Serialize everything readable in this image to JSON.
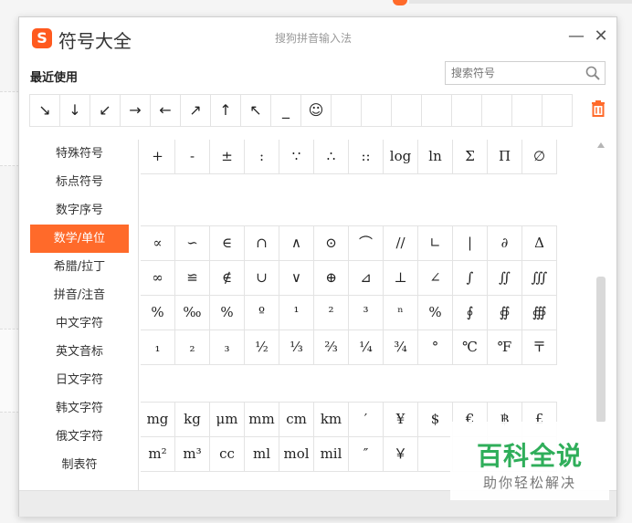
{
  "window": {
    "title": "符号大全",
    "subtitle": "搜狗拼音输入法",
    "minimize": "—",
    "close": "✕",
    "logo_glyph": "S"
  },
  "recent": {
    "label": "最近使用",
    "symbols": [
      "↘",
      "↓",
      "↙",
      "→",
      "←",
      "↗",
      "↑",
      "↖",
      "_",
      "☺",
      "",
      "",
      "",
      "",
      "",
      "",
      "",
      ""
    ]
  },
  "search": {
    "placeholder": "搜索符号"
  },
  "sidebar": {
    "items": [
      "特殊符号",
      "标点符号",
      "数字序号",
      "数学/单位",
      "希腊/拉丁",
      "拼音/注音",
      "中文字符",
      "英文音标",
      "日文字符",
      "韩文字符",
      "俄文字符",
      "制表符"
    ],
    "active": "数学/单位"
  },
  "grid": {
    "row_top": [
      "+",
      "-",
      "±",
      ":",
      "∵",
      "∴",
      "::",
      "log",
      "ln",
      "Σ",
      "Π",
      "∅"
    ],
    "row_math1": [
      "∝",
      "∽",
      "∈",
      "∩",
      "∧",
      "⊙",
      "⌒",
      "//",
      "∟",
      "|",
      "∂",
      "Δ"
    ],
    "row_math2": [
      "∞",
      "≌",
      "∉",
      "∪",
      "∨",
      "⊕",
      "⊿",
      "⊥",
      "∠",
      "∫",
      "∬",
      "∭"
    ],
    "row_math3": [
      "%",
      "‰",
      "%",
      "º",
      "¹",
      "²",
      "³",
      "ⁿ",
      "%",
      "∮",
      "∯",
      "∰"
    ],
    "row_math4": [
      "₁",
      "₂",
      "₃",
      "½",
      "⅓",
      "⅔",
      "¼",
      "¾",
      "°",
      "℃",
      "℉",
      "〒"
    ],
    "row_unit1": [
      "mg",
      "kg",
      "μm",
      "mm",
      "cm",
      "km",
      "′",
      "¥",
      "$",
      "€",
      "฿",
      "£"
    ],
    "row_unit2": [
      "m²",
      "m³",
      "cc",
      "ml",
      "mol",
      "mil",
      "″",
      "￥",
      "",
      "",
      "",
      ""
    ]
  },
  "watermark": {
    "title": "百科全说",
    "subtitle": "助你轻松解决"
  },
  "colors": {
    "accent": "#ff6a2a",
    "watermark_green": "#2fae5a"
  }
}
